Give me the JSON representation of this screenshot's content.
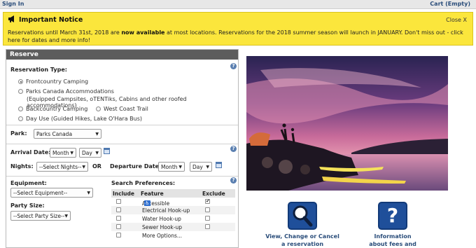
{
  "topbar": {
    "signin": "Sign In",
    "cart": "Cart (Empty)"
  },
  "notice": {
    "title": "Important Notice",
    "close": "Close X",
    "body_pre": "Reservations until March 31st, 2018 are ",
    "body_bold": "now available",
    "body_post": " at most locations. Reservations for the 2018 summer season will launch in JANUARY. Don't miss out - click here for dates and more info!"
  },
  "reserve": {
    "title": "Reserve",
    "reservation_type_label": "Reservation Type:",
    "types": {
      "frontcountry": "Frontcountry Camping",
      "accommodations": "Parks Canada Accommodations",
      "accommodations_sub": "(Equipped Campsites, oTENTiks, Cabins and other roofed accommodations)",
      "backcountry": "Backcountry Camping",
      "westcoast": "West Coast Trail",
      "dayuse": "Day Use (Guided Hikes, Lake O'Hara Bus)"
    },
    "park_label": "Park:",
    "park_value": "Parks Canada",
    "arrival_label": "Arrival Date:",
    "month": "Month",
    "day": "Day",
    "nights_label": "Nights:",
    "nights_value": "--Select Nights--",
    "or": "OR",
    "departure_label": "Departure Date:",
    "equipment_label": "Equipment:",
    "equipment_value": "--Select Equipment--",
    "party_label": "Party Size:",
    "party_value": "--Select Party Size--",
    "prefs_label": "Search Preferences:",
    "prefs_headers": {
      "include": "Include",
      "feature": "Feature",
      "exclude": "Exclude"
    },
    "prefs": {
      "accessible": "Accessible",
      "electrical": "Electrical Hook-up",
      "water": "Water Hook-up",
      "sewer": "Sewer Hook-up",
      "more": "More Options..."
    }
  },
  "tiles": {
    "view_line1": "View, Change or Cancel",
    "view_line2": "a reservation",
    "info_line1": "Information",
    "info_line2": "about fees and"
  },
  "icons": [
    "megaphone-icon",
    "help-icon",
    "calendar-icon",
    "wheelchair-icon",
    "magnifier-icon",
    "question-icon"
  ],
  "colors": {
    "notice_bg": "#fbe63c",
    "panel_head": "#5d5d5d",
    "link_blue": "#2a4d7a",
    "tile_blue": "#1f4f9a"
  }
}
